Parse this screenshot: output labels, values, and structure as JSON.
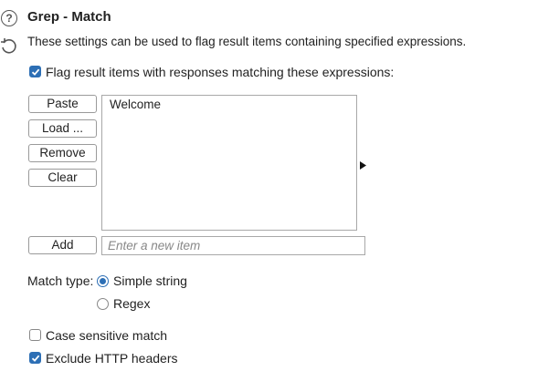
{
  "section": {
    "title": "Grep - Match",
    "description": "These settings can be used to flag result items containing specified expressions."
  },
  "flag_option": {
    "label": "Flag result items with responses matching these expressions:",
    "checked": true
  },
  "buttons": {
    "paste": "Paste",
    "load": "Load ...",
    "remove": "Remove",
    "clear": "Clear",
    "add": "Add"
  },
  "list": {
    "items": [
      "Welcome"
    ]
  },
  "new_item": {
    "placeholder": "Enter a new item",
    "value": ""
  },
  "match_type": {
    "label": "Match type:",
    "options": [
      {
        "label": "Simple string",
        "selected": true
      },
      {
        "label": "Regex",
        "selected": false
      }
    ]
  },
  "case_sensitive": {
    "label": "Case sensitive match",
    "checked": false
  },
  "exclude_headers": {
    "label": "Exclude HTTP headers",
    "checked": true
  },
  "colors": {
    "accent": "#2d6fb5"
  }
}
